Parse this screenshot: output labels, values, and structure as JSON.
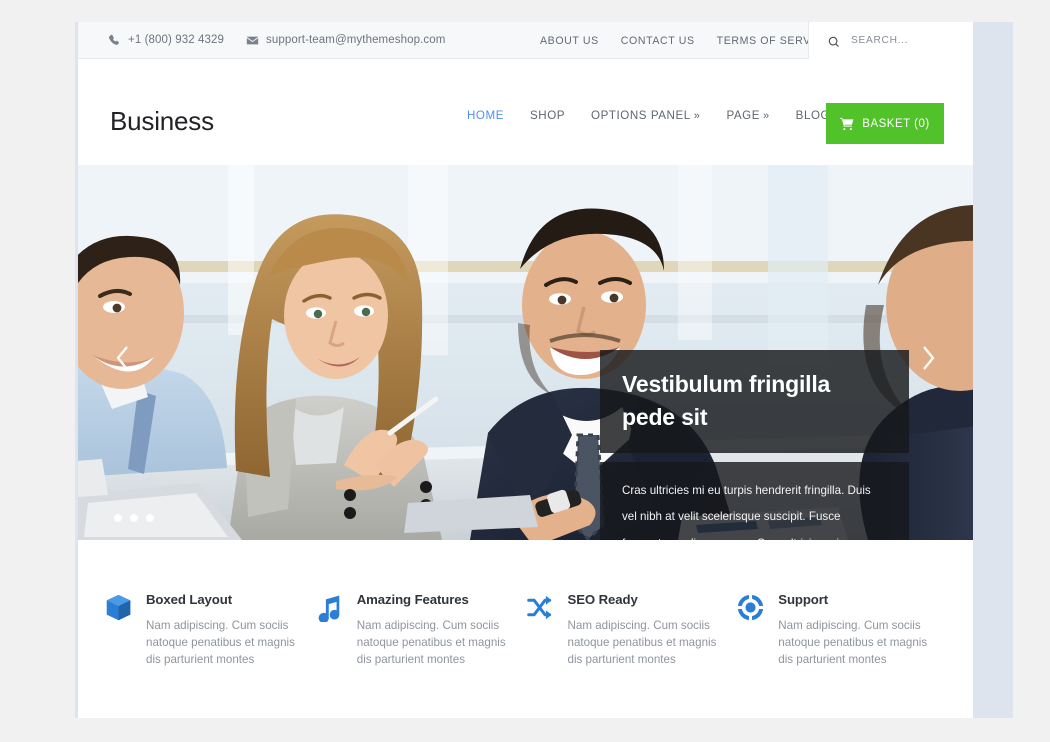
{
  "topbar": {
    "phone": "+1 (800) 932 4329",
    "phone_icon": "phone-icon",
    "email": "support-team@mythemeshop.com",
    "email_icon": "envelope-icon",
    "links": [
      {
        "label": "ABOUT US"
      },
      {
        "label": "CONTACT US"
      },
      {
        "label": "TERMS OF SERVICE"
      }
    ],
    "search": {
      "icon": "search-icon",
      "placeholder": "SEARCH...",
      "value": ""
    }
  },
  "header": {
    "logo": "Business",
    "nav": [
      {
        "label": "HOME",
        "active": true,
        "caret": ""
      },
      {
        "label": "SHOP",
        "active": false,
        "caret": ""
      },
      {
        "label": "OPTIONS PANEL",
        "active": false,
        "caret": "»"
      },
      {
        "label": "PAGE",
        "active": false,
        "caret": "»"
      },
      {
        "label": "BLOG",
        "active": false,
        "caret": ""
      }
    ],
    "basket": {
      "label": "BASKET (0)",
      "icon": "shopping-cart-icon",
      "color": "#52c22b"
    }
  },
  "slider": {
    "alt": "Business team meeting at a table in a bright office",
    "prev_icon": "chevron-left-icon",
    "next_icon": "chevron-right-icon",
    "dots": 3,
    "active_dot": 0,
    "caption": {
      "title": "Vestibulum fringilla pede sit",
      "text": "Cras ultricies mi eu turpis hendrerit fringilla. Duis vel nibh at velit scelerisque suscipit. Fusce fermentum odio nec arcu. Cras ultricies mi eu turpis."
    }
  },
  "features": [
    {
      "icon": "box-icon",
      "title": "Boxed Layout",
      "desc": "Nam adipiscing. Cum sociis natoque penatibus et magnis dis parturient montes"
    },
    {
      "icon": "music-note-icon",
      "title": "Amazing Features",
      "desc": "Nam adipiscing. Cum sociis natoque penatibus et magnis dis parturient montes"
    },
    {
      "icon": "shuffle-icon",
      "title": "SEO Ready",
      "desc": "Nam adipiscing. Cum sociis natoque penatibus et magnis dis parturient montes"
    },
    {
      "icon": "lifebuoy-icon",
      "title": "Support",
      "desc": "Nam adipiscing. Cum sociis natoque penatibus et magnis dis parturient montes"
    }
  ],
  "colors": {
    "accent_blue": "#4f8ff0",
    "brand_green": "#52c22b",
    "icon_blue": "#2a7fd4",
    "page_bg": "#f1f1f1",
    "frame_bg": "#dee4ee"
  }
}
